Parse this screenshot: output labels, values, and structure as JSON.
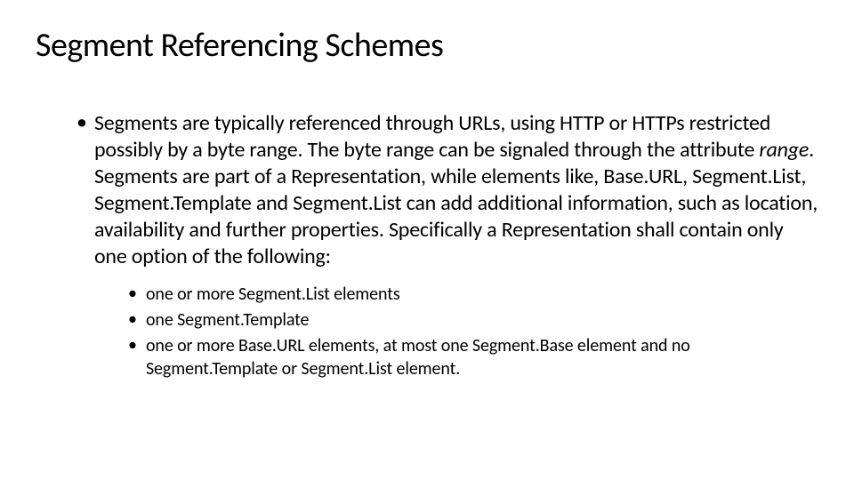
{
  "title": "Segment Referencing Schemes",
  "main_bullet": {
    "text_part1": "Segments are typically referenced through URLs, using HTTP or HTTPs restricted possibly by a byte range. The byte range can be signaled through the attribute ",
    "italic_word": "range",
    "text_part2": ". Segments are part of a Representation, while elements like, Base.URL, Segment.List, Segment.Template and Segment.List can add additional information, such as location, availability and further properties. Specifically a Representation shall contain only one option of the following:"
  },
  "sub_bullets": [
    "one or more Segment.List elements",
    "one Segment.Template",
    "one or more Base.URL elements, at most one Segment.Base element and no Segment.Template or Segment.List element."
  ]
}
